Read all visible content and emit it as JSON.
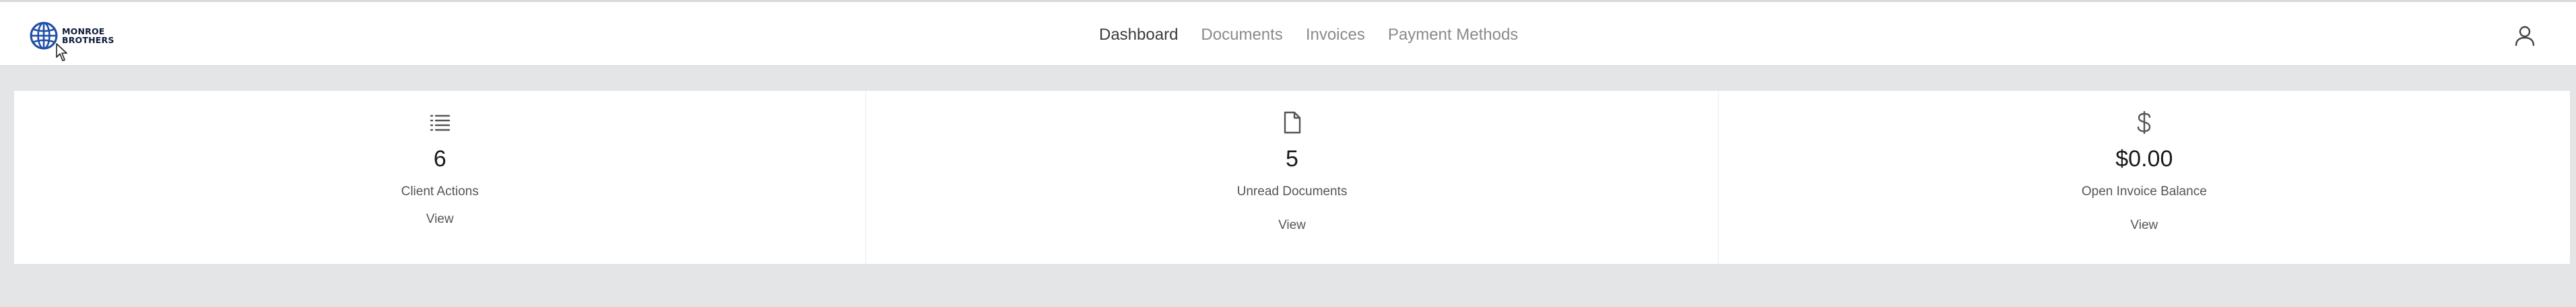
{
  "brand": {
    "line1": "MONROE",
    "line2": "BROTHERS",
    "logo_icon": "globe-icon",
    "color": "#1f4fa8"
  },
  "nav": {
    "items": [
      {
        "label": "Dashboard",
        "active": true
      },
      {
        "label": "Documents",
        "active": false
      },
      {
        "label": "Invoices",
        "active": false
      },
      {
        "label": "Payment Methods",
        "active": false
      }
    ]
  },
  "header": {
    "user_icon": "user-icon"
  },
  "cards": [
    {
      "icon": "list-icon",
      "value": "6",
      "label": "Client Actions",
      "link": "View"
    },
    {
      "icon": "document-icon",
      "value": "5",
      "label": "Unread Documents",
      "link": "View"
    },
    {
      "icon": "dollar-icon",
      "value": "$0.00",
      "label": "Open Invoice Balance",
      "link": "View"
    }
  ]
}
